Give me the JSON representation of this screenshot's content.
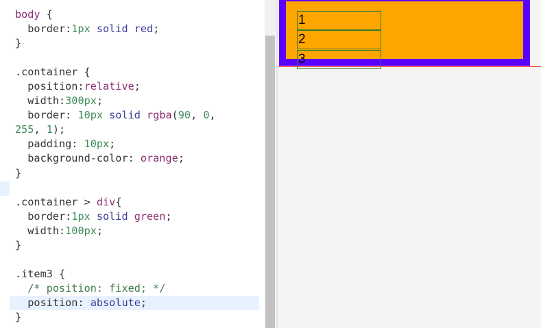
{
  "editor": {
    "lines": [
      [
        {
          "t": "body",
          "c": "t-tag"
        },
        {
          "t": " {",
          "c": "t-pun"
        }
      ],
      [
        {
          "t": "  border:",
          "c": "t-prop"
        },
        {
          "t": "1px",
          "c": "t-num"
        },
        {
          "t": " solid ",
          "c": "t-val"
        },
        {
          "t": "red",
          "c": "t-val"
        },
        {
          "t": ";",
          "c": "t-pun"
        }
      ],
      [
        {
          "t": "}",
          "c": "t-pun"
        }
      ],
      [],
      [
        {
          "t": ".container",
          "c": "t-sel"
        },
        {
          "t": " {",
          "c": "t-pun"
        }
      ],
      [
        {
          "t": "  position:",
          "c": "t-prop"
        },
        {
          "t": "relative",
          "c": "t-tag"
        },
        {
          "t": ";",
          "c": "t-pun"
        }
      ],
      [
        {
          "t": "  width:",
          "c": "t-prop"
        },
        {
          "t": "300px",
          "c": "t-num"
        },
        {
          "t": ";",
          "c": "t-pun"
        }
      ],
      [
        {
          "t": "  border: ",
          "c": "t-prop"
        },
        {
          "t": "10px",
          "c": "t-num"
        },
        {
          "t": " solid ",
          "c": "t-val"
        },
        {
          "t": "rgba",
          "c": "t-tag"
        },
        {
          "t": "(",
          "c": "t-pun"
        },
        {
          "t": "90",
          "c": "t-num"
        },
        {
          "t": ", ",
          "c": "t-pun"
        },
        {
          "t": "0",
          "c": "t-num"
        },
        {
          "t": ",",
          "c": "t-pun"
        }
      ],
      [
        {
          "t": "255",
          "c": "t-num"
        },
        {
          "t": ", ",
          "c": "t-pun"
        },
        {
          "t": "1",
          "c": "t-num"
        },
        {
          "t": ");",
          "c": "t-pun"
        }
      ],
      [
        {
          "t": "  padding: ",
          "c": "t-prop"
        },
        {
          "t": "10px",
          "c": "t-num"
        },
        {
          "t": ";",
          "c": "t-pun"
        }
      ],
      [
        {
          "t": "  background-color: ",
          "c": "t-prop"
        },
        {
          "t": "orange",
          "c": "t-tag"
        },
        {
          "t": ";",
          "c": "t-pun"
        }
      ],
      [
        {
          "t": "}",
          "c": "t-pun"
        }
      ],
      [],
      [
        {
          "t": ".container",
          "c": "t-sel"
        },
        {
          "t": " > ",
          "c": "t-pun"
        },
        {
          "t": "div",
          "c": "t-tag"
        },
        {
          "t": "{",
          "c": "t-pun"
        }
      ],
      [
        {
          "t": "  border:",
          "c": "t-prop"
        },
        {
          "t": "1px",
          "c": "t-num"
        },
        {
          "t": " solid ",
          "c": "t-val"
        },
        {
          "t": "green",
          "c": "t-tag"
        },
        {
          "t": ";",
          "c": "t-pun"
        }
      ],
      [
        {
          "t": "  width:",
          "c": "t-prop"
        },
        {
          "t": "100px",
          "c": "t-num"
        },
        {
          "t": ";",
          "c": "t-pun"
        }
      ],
      [
        {
          "t": "}",
          "c": "t-pun"
        }
      ],
      [],
      [
        {
          "t": ".item3",
          "c": "t-sel"
        },
        {
          "t": " {",
          "c": "t-pun"
        }
      ],
      [
        {
          "t": "  /* position: fixed; */",
          "c": "t-cmt"
        }
      ],
      [
        {
          "t": "  position: ",
          "c": "t-prop"
        },
        {
          "t": "absolute",
          "c": "t-val"
        },
        {
          "t": ";",
          "c": "t-pun"
        }
      ],
      [
        {
          "t": "}",
          "c": "t-pun"
        }
      ]
    ],
    "active_line": 20
  },
  "preview": {
    "items": [
      "1",
      "2",
      "3"
    ],
    "colors": {
      "container_bg": "#ffa500",
      "container_border": "#5a00ff",
      "body_border": "#ff0000",
      "item_border": "#2e7d2e"
    }
  }
}
